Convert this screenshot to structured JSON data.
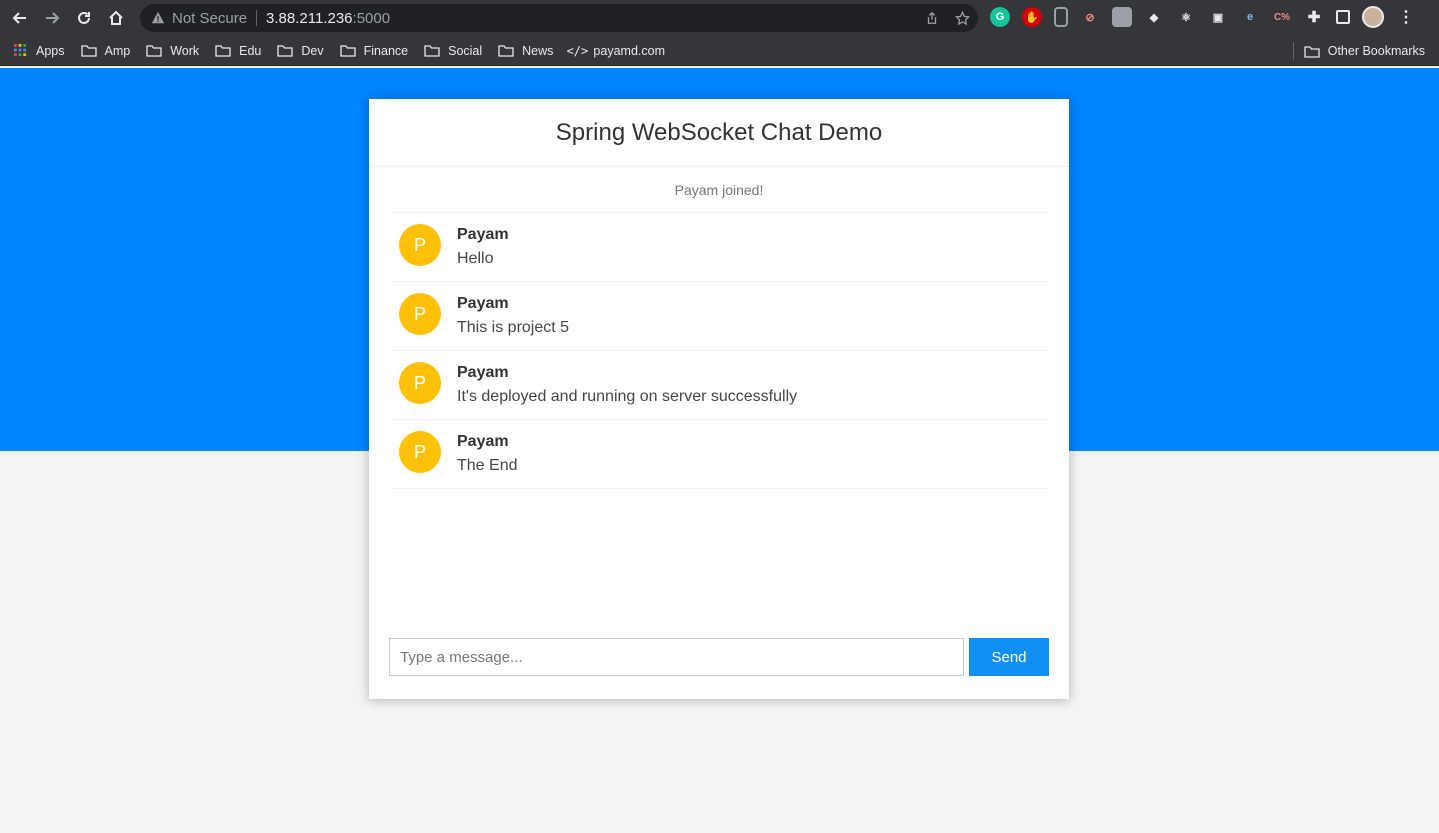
{
  "browser": {
    "security_label": "Not Secure",
    "host": "3.88.211.236",
    "port": ":5000",
    "bookmarks": [
      "Apps",
      "Amp",
      "Work",
      "Edu",
      "Dev",
      "Finance",
      "Social",
      "News",
      "payamd.com"
    ],
    "other_bookmarks": "Other Bookmarks"
  },
  "chat": {
    "title": "Spring WebSocket Chat Demo",
    "event": "Payam joined!",
    "messages": [
      {
        "avatar": "P",
        "sender": "Payam",
        "text": "Hello"
      },
      {
        "avatar": "P",
        "sender": "Payam",
        "text": "This is project 5"
      },
      {
        "avatar": "P",
        "sender": "Payam",
        "text": "It's deployed and running on server successfully"
      },
      {
        "avatar": "P",
        "sender": "Payam",
        "text": "The End"
      }
    ],
    "input_placeholder": "Type a message...",
    "send_label": "Send"
  },
  "colors": {
    "header_band": "#0084ff",
    "avatar": "#ffc107",
    "send_button": "#128ff2"
  }
}
